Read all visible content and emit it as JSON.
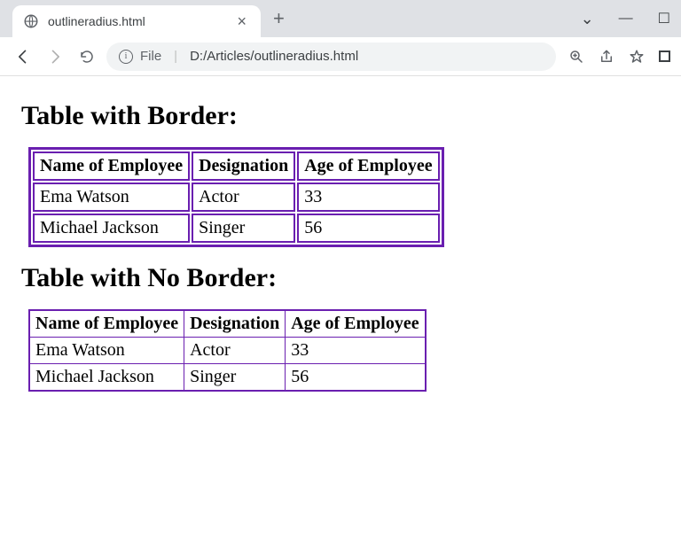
{
  "browser": {
    "tab_title": "outlineradius.html",
    "url_prefix": "File",
    "url_path": "D:/Articles/outlineradius.html"
  },
  "page": {
    "heading1": "Table with Border:",
    "heading2": "Table with No Border:",
    "table": {
      "headers": {
        "c1": "Name of Employee",
        "c2": "Designation",
        "c3": "Age of Employee"
      },
      "rows": [
        {
          "c1": "Ema Watson",
          "c2": "Actor",
          "c3": "33"
        },
        {
          "c1": "Michael Jackson",
          "c2": "Singer",
          "c3": "56"
        }
      ]
    }
  }
}
